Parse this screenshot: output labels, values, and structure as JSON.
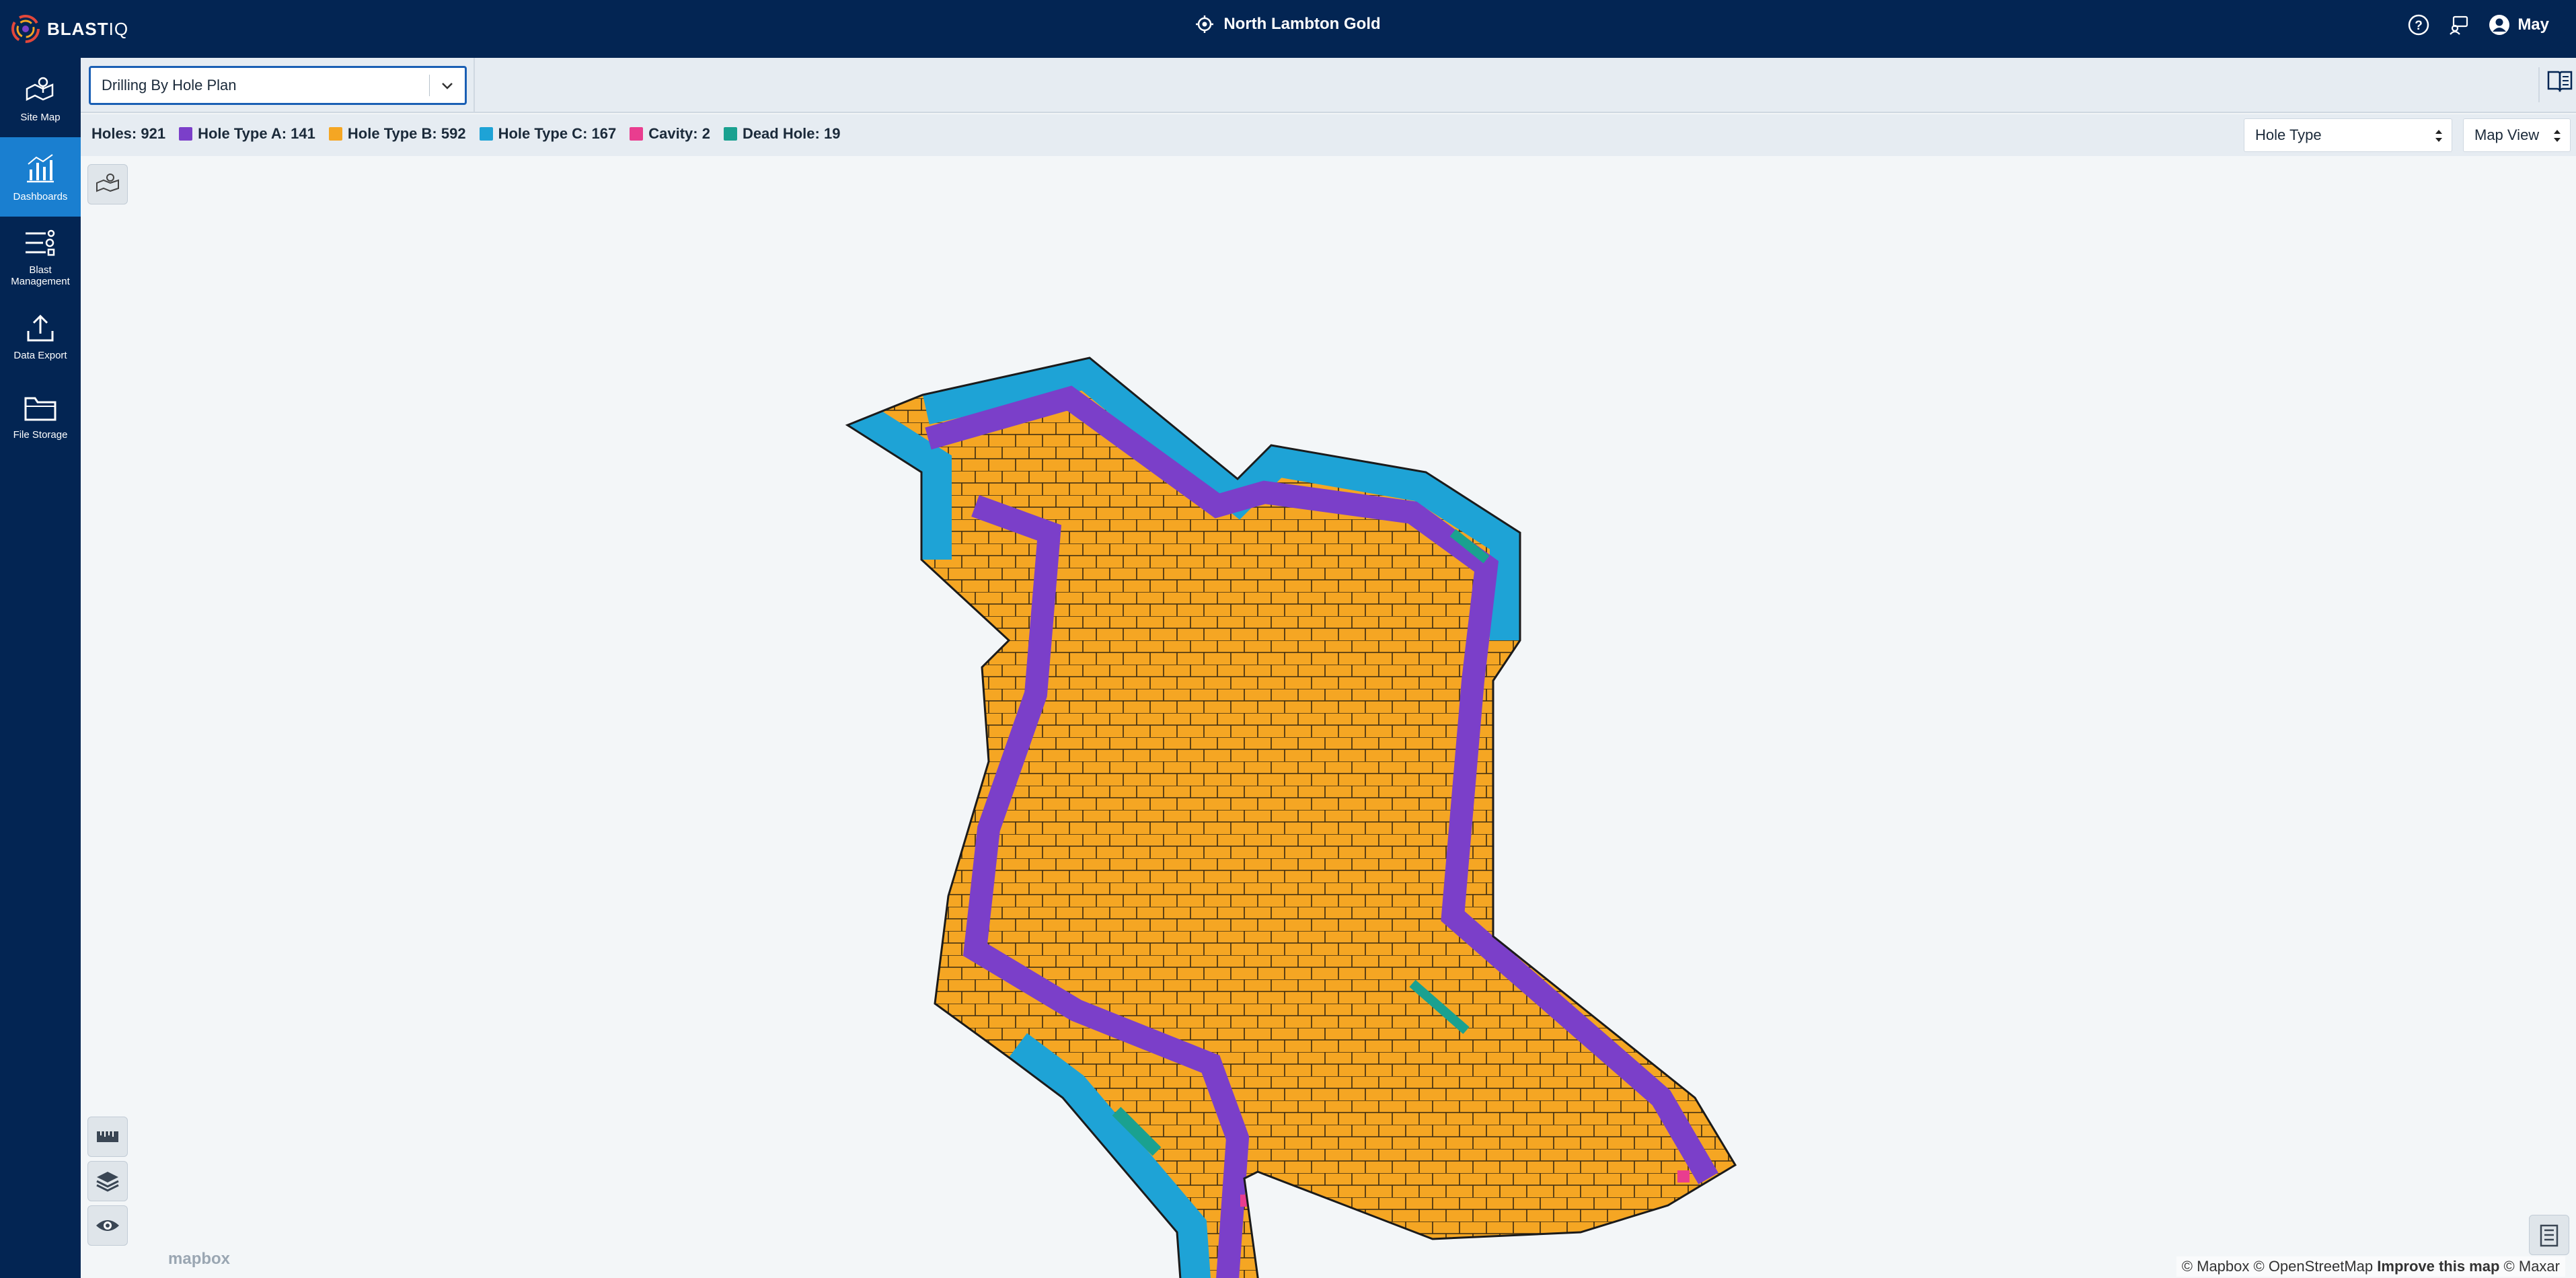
{
  "app": {
    "logo_text": "BLAST",
    "logo_accent": "IQ"
  },
  "header": {
    "site_name": "North Lambton Gold",
    "user_name": "May"
  },
  "sidebar": {
    "items": [
      {
        "label": "Site Map",
        "icon": "site-map-icon",
        "active": false
      },
      {
        "label": "Dashboards",
        "icon": "dashboards-icon",
        "active": true
      },
      {
        "label": "Blast Management",
        "icon": "blast-management-icon",
        "active": false
      },
      {
        "label": "Data Export",
        "icon": "data-export-icon",
        "active": false
      },
      {
        "label": "File Storage",
        "icon": "file-storage-icon",
        "active": false
      }
    ]
  },
  "toolbar": {
    "plan_select_value": "Drilling By Hole Plan"
  },
  "legend": {
    "holes_label": "Holes: 921",
    "items": [
      {
        "label": "Hole Type A: 141",
        "color": "#7b3fc9"
      },
      {
        "label": "Hole Type B: 592",
        "color": "#f5a623"
      },
      {
        "label": "Hole Type C: 167",
        "color": "#1ea3d6"
      },
      {
        "label": "Cavity: 2",
        "color": "#e93d8f"
      },
      {
        "label": "Dead Hole: 19",
        "color": "#1aa190"
      }
    ]
  },
  "controls": {
    "color_by": "Hole Type",
    "view_mode": "Map View"
  },
  "map": {
    "mapbox_text": "mapbox",
    "attribution": "© Mapbox © OpenStreetMap",
    "improve_text": "Improve this map",
    "maxar_text": "© Maxar"
  },
  "colors": {
    "navy": "#032553",
    "active_blue": "#1a7fd0"
  }
}
